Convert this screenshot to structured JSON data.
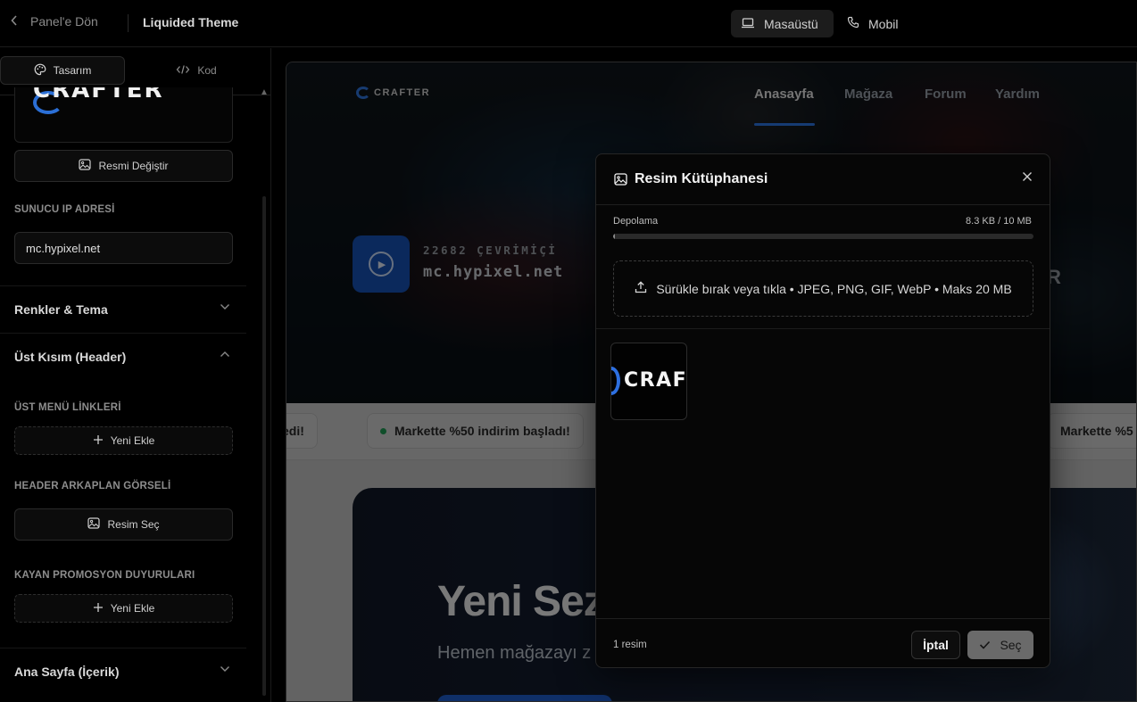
{
  "topbar": {
    "back_label": "Panel'e Dön",
    "theme_name": "Liquided Theme",
    "devices": [
      {
        "label": "Masaüstü",
        "icon": "laptop-icon",
        "active": true
      },
      {
        "label": "Mobil",
        "icon": "phone-icon",
        "active": false
      }
    ]
  },
  "sidebar": {
    "tabs": [
      {
        "label": "Tasarım",
        "icon": "palette-icon",
        "active": true
      },
      {
        "label": "Kod",
        "icon": "code-icon",
        "active": false
      }
    ],
    "logo_text": "CRAFTER",
    "change_image_label": "Resmi Değiştir",
    "server_ip_label": "SUNUCU IP ADRESİ",
    "server_ip_value": "mc.hypixel.net",
    "sections": {
      "colors": "Renkler & Tema",
      "header": "Üst Kısım (Header)",
      "home": "Ana Sayfa (İçerik)"
    },
    "menu_links_label": "ÜST MENÜ LİNKLERİ",
    "add_new_label": "Yeni Ekle",
    "header_bg_label": "HEADER ARKAPLAN GÖRSELİ",
    "choose_image_label": "Resim Seç",
    "promo_label": "KAYAN PROMOSYON DUYURULARI",
    "add_new_label_2": "Yeni Ekle"
  },
  "preview": {
    "logo": "CRAFTER",
    "nav": [
      "Anasayfa",
      "Mağaza",
      "Forum",
      "Yardım"
    ],
    "online": "22682 ÇEVRİMİÇİ",
    "ip": "mc.hypixel.net",
    "hero_fragment": "R",
    "ticker": [
      "edi!",
      "Markette %50 indirim başladı!",
      "Markette %5"
    ],
    "banner_title": "Yeni Sez",
    "banner_sub": "Hemen mağazayı z"
  },
  "modal": {
    "title": "Resim Kütüphanesi",
    "storage_label": "Depolama",
    "storage_value": "8.3 KB / 10 MB",
    "storage_fraction": 0.0008,
    "dropzone_text": "Sürükle bırak veya tıkla • JPEG, PNG, GIF, WebP • Maks 20 MB",
    "thumb_text": "CRAF",
    "count": "1 resim",
    "cancel_label": "İptal",
    "select_label": "Seç"
  },
  "colors": {
    "accent": "#2f78e8",
    "background": "#000000"
  }
}
